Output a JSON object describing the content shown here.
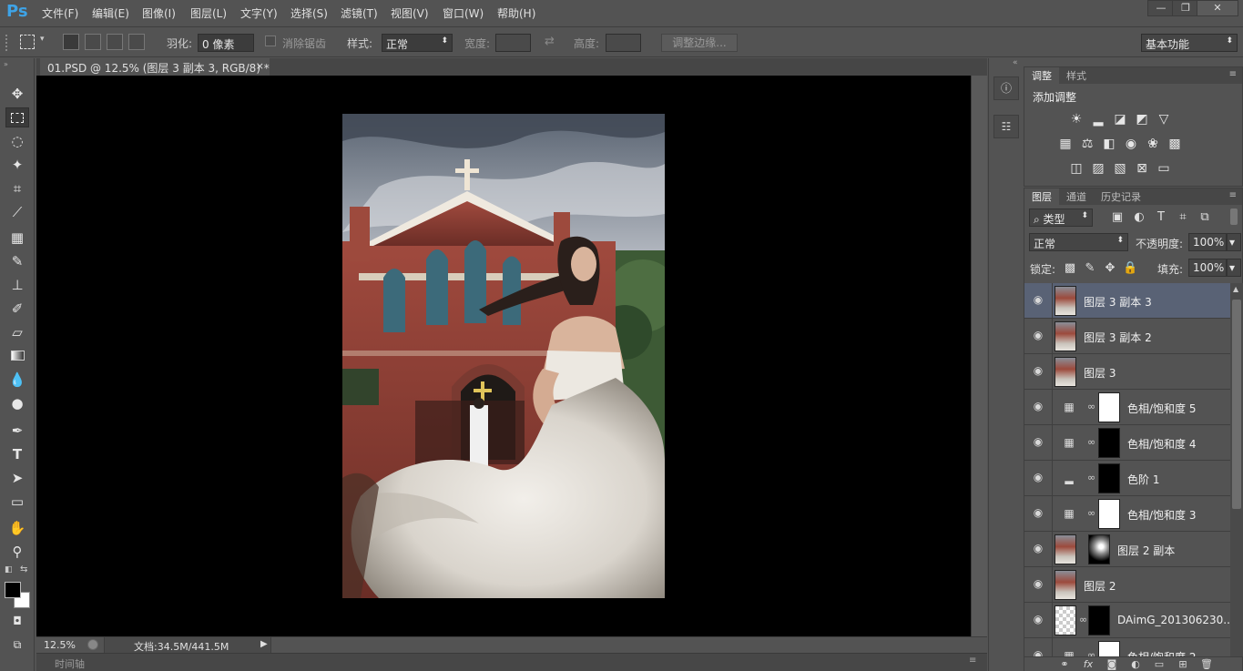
{
  "app": {
    "logo": "Ps"
  },
  "menu": [
    "文件(F)",
    "编辑(E)",
    "图像(I)",
    "图层(L)",
    "文字(Y)",
    "选择(S)",
    "滤镜(T)",
    "视图(V)",
    "窗口(W)",
    "帮助(H)"
  ],
  "window_controls": {
    "minimize": "—",
    "restore": "❐",
    "close": "✕"
  },
  "options": {
    "feather_label": "羽化:",
    "feather_value": "0 像素",
    "antialias_label": "消除锯齿",
    "style_label": "样式:",
    "style_value": "正常",
    "width_label": "宽度:",
    "height_label": "高度:",
    "refine_edge": "调整边缘...",
    "workspace": "基本功能"
  },
  "document": {
    "tab_title": "01.PSD @ 12.5% (图层 3 副本 3, RGB/8) *",
    "close": "×",
    "zoom": "12.5%",
    "doc_size": "文档:34.5M/441.5M"
  },
  "timeline": {
    "label": "时间轴"
  },
  "adjustments": {
    "tabs": [
      "调整",
      "样式"
    ],
    "heading": "添加调整",
    "icons": [
      [
        "brightness-icon",
        "levels-icon",
        "curves-icon",
        "exposure-icon",
        "vibrance-icon"
      ],
      [
        "hue-saturation-icon",
        "color-balance-icon",
        "black-white-icon",
        "photo-filter-icon",
        "channel-mixer-icon",
        "color-lookup-icon"
      ],
      [
        "invert-icon",
        "posterize-icon",
        "threshold-icon",
        "selective-color-icon",
        "gradient-map-icon"
      ]
    ]
  },
  "layers_panel": {
    "tabs": [
      "图层",
      "通道",
      "历史记录"
    ],
    "filter_kind": "类型",
    "blend_mode": "正常",
    "opacity_label": "不透明度:",
    "opacity_value": "100%",
    "lock_label": "锁定:",
    "fill_label": "填充:",
    "fill_value": "100%",
    "layers": [
      {
        "name": "图层 3 副本 3",
        "type": "pixel",
        "selected": true
      },
      {
        "name": "图层 3 副本 2",
        "type": "pixel",
        "selected": false
      },
      {
        "name": "图层 3",
        "type": "pixel",
        "selected": false
      },
      {
        "name": "色相/饱和度 5",
        "type": "hue-saturation",
        "mask": "white",
        "selected": false
      },
      {
        "name": "色相/饱和度 4",
        "type": "hue-saturation",
        "mask": "black",
        "selected": false
      },
      {
        "name": "色阶 1",
        "type": "levels",
        "mask": "black",
        "selected": false
      },
      {
        "name": "色相/饱和度 3",
        "type": "hue-saturation",
        "mask": "white",
        "selected": false
      },
      {
        "name": "图层 2 副本",
        "type": "pixel-masked",
        "mask": "soft",
        "selected": false
      },
      {
        "name": "图层 2",
        "type": "pixel",
        "selected": false
      },
      {
        "name": "DAimG_201306230...",
        "type": "pixel-masked-trans",
        "mask": "black",
        "selected": false
      },
      {
        "name": "色相/饱和度 2",
        "type": "hue-saturation",
        "mask": "white",
        "selected": false
      }
    ]
  },
  "colors": {
    "ps_blue": "#3ea3e6",
    "selected_layer": "#596275",
    "panel_bg": "#535353"
  }
}
